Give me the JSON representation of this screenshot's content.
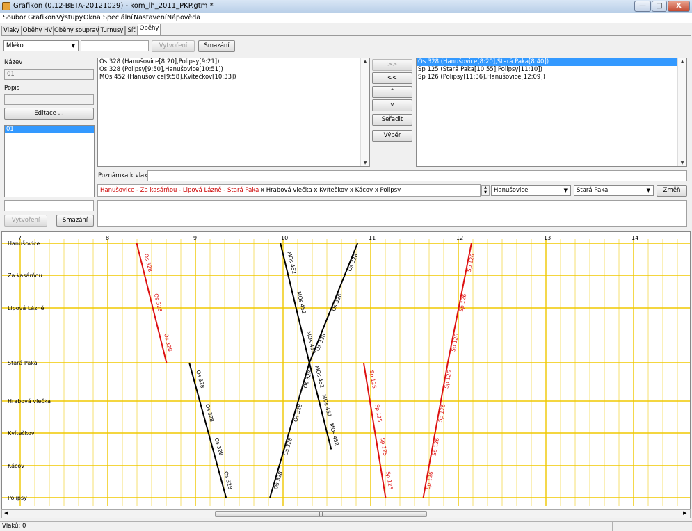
{
  "window": {
    "title": "Grafikon (0.12-BETA-20121029) - kom_lh_2011_PKP.gtm *",
    "min_label": "—",
    "max_label": "□",
    "close_label": "X"
  },
  "menu": [
    "Soubor",
    "Grafikon",
    "Výstupy",
    "Okna",
    "Speciální",
    "Nastavení",
    "Nápověda"
  ],
  "tabs": [
    "Vlaky",
    "Oběhy HV",
    "Oběhy souprav",
    "Turnusy",
    "Síť",
    "Oběhy"
  ],
  "toolbar": {
    "combo_value": "Mléko",
    "name_input": "",
    "create_label": "Vytvoření",
    "delete_label": "Smazání"
  },
  "left": {
    "name_label": "Název",
    "name_value": "01",
    "desc_label": "Popis",
    "desc_value": "",
    "edit_label": "Editace ...",
    "items": [
      "01"
    ],
    "bottom_input": "",
    "create_label": "Vytvoření",
    "delete_label": "Smazání"
  },
  "available_trains": [
    "Os 328 (Hanušovice[8:20],Polipsy[9:21])",
    "Os 328 (Polipsy[9:50],Hanušovice[10:51])",
    "MOs 452 (Hanušovice[9:58],Kvítečkov[10:33])"
  ],
  "move_buttons": {
    "add": ">>",
    "remove": "<<",
    "up": "^",
    "down": "v",
    "sort": "Seřadit",
    "select": "Výběr"
  },
  "circulation": [
    "Os 328 (Hanušovice[8:20],Stará Paka[8:40])",
    "Sp 125 (Stará Paka[10:55],Polipsy[11:10])",
    "Sp 126 (Polipsy[11:36],Hanušovice[12:09])"
  ],
  "note": {
    "label": "Poznámka k vlaku:",
    "value": ""
  },
  "route": {
    "red": "Hanušovice - Za kasárňou - Lipová Lázně - Stará Paka",
    "black": " x Hrabová vlečka x Kvítečkov x Kácov x Polipsy",
    "from": "Hanušovice",
    "to": "Stará Paka",
    "change_label": "Změň"
  },
  "chart_data": {
    "type": "line",
    "title": "",
    "x_unit": "hour",
    "hours": [
      "7",
      "8",
      "9",
      "10",
      "11",
      "12",
      "13",
      "14"
    ],
    "stations": [
      "Hanušovice",
      "Za kasárňou",
      "Lipová Lázně",
      "Stará Paka",
      "Hrabová vlečka",
      "Kvítečkov",
      "Kácov",
      "Polipsy"
    ],
    "colors": {
      "grid": "#f0c800",
      "highlight": "#dd1111",
      "normal": "#000000"
    },
    "trains": [
      {
        "name": "Os 328",
        "highlight": true,
        "segments": [
          [
            8.33,
            0
          ],
          [
            8.67,
            3
          ]
        ]
      },
      {
        "name": "Os 328",
        "highlight": false,
        "segments": [
          [
            8.93,
            3
          ],
          [
            9.35,
            7
          ]
        ]
      },
      {
        "name": "Os 328",
        "highlight": false,
        "segments": [
          [
            9.85,
            7
          ],
          [
            10.3,
            3
          ],
          [
            10.85,
            0
          ]
        ]
      },
      {
        "name": "MOs 452",
        "highlight": false,
        "segments": [
          [
            9.97,
            0
          ],
          [
            10.3,
            3
          ],
          [
            10.55,
            5.5
          ]
        ]
      },
      {
        "name": "Sp 125",
        "highlight": true,
        "segments": [
          [
            10.92,
            3
          ],
          [
            11.17,
            7
          ]
        ]
      },
      {
        "name": "Sp 126",
        "highlight": true,
        "segments": [
          [
            11.6,
            7
          ],
          [
            11.88,
            3
          ],
          [
            12.15,
            0
          ]
        ]
      }
    ]
  },
  "scroll_thumb": "III",
  "status": {
    "trains_count": "Vlaků: 0"
  }
}
